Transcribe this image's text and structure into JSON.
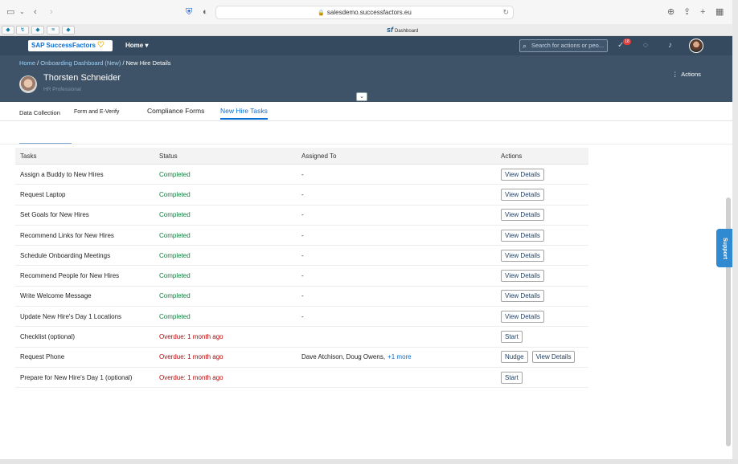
{
  "browser": {
    "url": "salesdemo.successfactors.eu",
    "tab_title": "Dashboard",
    "tab_logo": "sf"
  },
  "shell": {
    "logo_text": "SAP SuccessFactors",
    "home_label": "Home",
    "search_placeholder": "Search for actions or peo...",
    "notification_count": "18"
  },
  "header": {
    "breadcrumb": {
      "home": "Home",
      "sep": "/",
      "onboarding": "Onboarding Dashboard (New)",
      "current": "New Hire Details"
    },
    "employee_name": "Thorsten Schneider",
    "employee_title": "HR Professional",
    "actions_label": "Actions"
  },
  "tabs": [
    {
      "label": "Data Collection"
    },
    {
      "label": "Form and E-Verify"
    },
    {
      "label": "Compliance Forms"
    },
    {
      "label": "New Hire Tasks"
    }
  ],
  "table": {
    "headers": {
      "tasks": "Tasks",
      "status": "Status",
      "assigned": "Assigned To",
      "actions": "Actions"
    },
    "rows": [
      {
        "task": "Assign a Buddy to New Hires",
        "status": "Completed",
        "assigned": "-",
        "btn1": "View Details"
      },
      {
        "task": "Request Laptop",
        "status": "Completed",
        "assigned": "-",
        "btn1": "View Details"
      },
      {
        "task": "Set Goals for New Hires",
        "status": "Completed",
        "assigned": "-",
        "btn1": "View Details"
      },
      {
        "task": "Recommend Links for New Hires",
        "status": "Completed",
        "assigned": "-",
        "btn1": "View Details"
      },
      {
        "task": "Schedule Onboarding Meetings",
        "status": "Completed",
        "assigned": "-",
        "btn1": "View Details"
      },
      {
        "task": "Recommend People for New Hires",
        "status": "Completed",
        "assigned": "-",
        "btn1": "View Details"
      },
      {
        "task": "Write Welcome Message",
        "status": "Completed",
        "assigned": "-",
        "btn1": "View Details"
      },
      {
        "task": "Update New Hire's Day 1 Locations",
        "status": "Completed",
        "assigned": "-",
        "btn1": "View Details"
      },
      {
        "task": "Checklist (optional)",
        "status": "Overdue: 1 month ago",
        "assigned": "",
        "btn1": "Start"
      },
      {
        "task": "Request Phone",
        "status": "Overdue: 1 month ago",
        "assigned": "Dave Atchison, Doug Owens,",
        "more": "+1 more",
        "btn1": "Nudge",
        "btn2": "View Details"
      },
      {
        "task": "Prepare for New Hire's Day 1 (optional)",
        "status": "Overdue: 1 month ago",
        "assigned": "",
        "btn1": "Start"
      }
    ]
  },
  "support_label": "Support",
  "colors": {
    "shell": "#354a5f",
    "header": "#3e5368",
    "accent": "#0a6ed1",
    "completed": "#107e3e",
    "overdue": "#bb0000"
  }
}
